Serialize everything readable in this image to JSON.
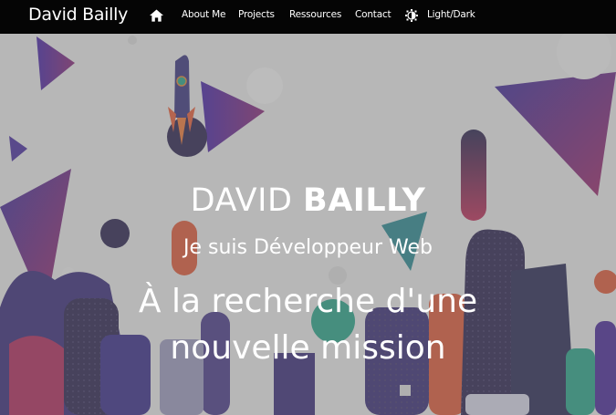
{
  "nav": {
    "brand": "David Bailly",
    "home_icon": "home-icon",
    "links": [
      "About Me",
      "Projects",
      "Ressources",
      "Contact"
    ],
    "theme_icon": "contrast-icon",
    "theme_label": "Light/Dark"
  },
  "hero": {
    "first_name": "DAVID",
    "last_name": "BAILLY",
    "subtitle": "Je suis Développeur Web",
    "mission_line1": "À la recherche d'une",
    "mission_line2": "nouvelle mission"
  },
  "colors": {
    "navbar": "#050505",
    "text": "#ffffff",
    "purple": "#4b2a9a",
    "magenta": "#a8245c",
    "teal": "#2aa58a",
    "navy": "#2b2450",
    "orange": "#e0603a"
  }
}
